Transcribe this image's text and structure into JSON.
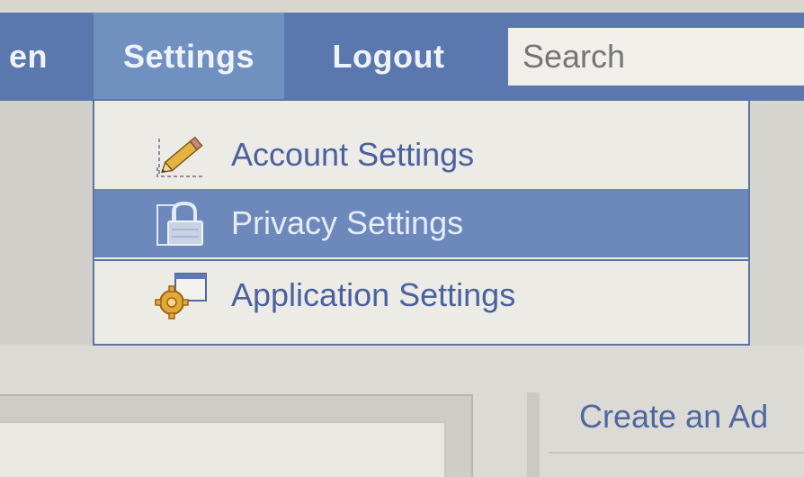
{
  "navbar": {
    "partial_item": "en",
    "settings_label": "Settings",
    "logout_label": "Logout",
    "search_placeholder": "Search"
  },
  "settings_menu": {
    "items": [
      {
        "label": "Account Settings",
        "icon": "pencil-icon"
      },
      {
        "label": "Privacy Settings",
        "icon": "lock-icon",
        "highlighted": true
      },
      {
        "label": "Application Settings",
        "icon": "gear-icon"
      }
    ]
  },
  "sidebar": {
    "create_ad_label": "Create an Ad"
  },
  "colors": {
    "navbar_bg": "#5a78ad",
    "nav_active_bg": "#7090c0",
    "menu_highlight_bg": "#6d89bc",
    "link_text": "#4a61a0"
  }
}
